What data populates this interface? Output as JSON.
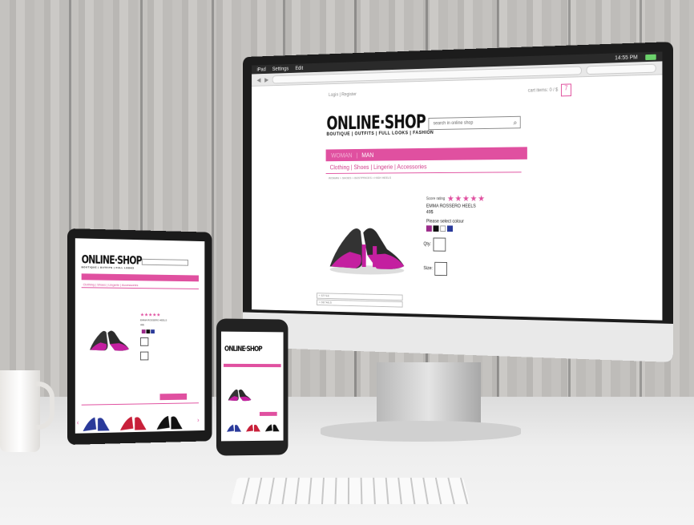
{
  "monitor": {
    "statusbar": {
      "left": [
        "iPad",
        "Settings",
        "Edit"
      ],
      "clock": "14:55 PM"
    },
    "top_links": "Login | Register",
    "cart": {
      "label": "cart items: 0 / $",
      "count": "7"
    },
    "logo": {
      "main": "ONLINE·SHOP",
      "sub": "BOUTIQUE | OUTFITS | FULL LOOKS | FASHION"
    },
    "search": {
      "placeholder": "search in online shop"
    },
    "gender_nav": {
      "woman": "WOMAN",
      "sep": "|",
      "man": "MAN"
    },
    "categories": "Clothing | Shoes | Lingerie | Accessories",
    "breadcrumb": "WOMAN > SHOES > BESTPRICES > HIGH HEELS",
    "product": {
      "rating_label": "Score rating",
      "stars": "★★★★★",
      "name": "EMMA ROSSERO HEELS",
      "price": "49$",
      "colour_label": "Please select colour",
      "qty_label": "Qty:",
      "size_label": "Size:"
    },
    "tabs": [
      "+ STYLE",
      "+ DETAILS"
    ]
  },
  "tablet": {
    "logo": {
      "main": "ONLINE·SHOP",
      "sub": "BOUTIQUE | OUTFITS | FULL LOOKS"
    },
    "categories": "Clothing | Shoes | Lingerie | Accessories",
    "stars": "★★★★★",
    "name": "EMMA ROSSERO HEELS",
    "price": "49$"
  },
  "phone": {
    "logo": {
      "main": "ONLINE·SHOP"
    }
  },
  "colors": {
    "accent": "#e050a0",
    "swatch_purple": "#9b2a8a",
    "swatch_black": "#111111",
    "swatch_white": "#ffffff",
    "swatch_blue": "#2a3a9a"
  }
}
